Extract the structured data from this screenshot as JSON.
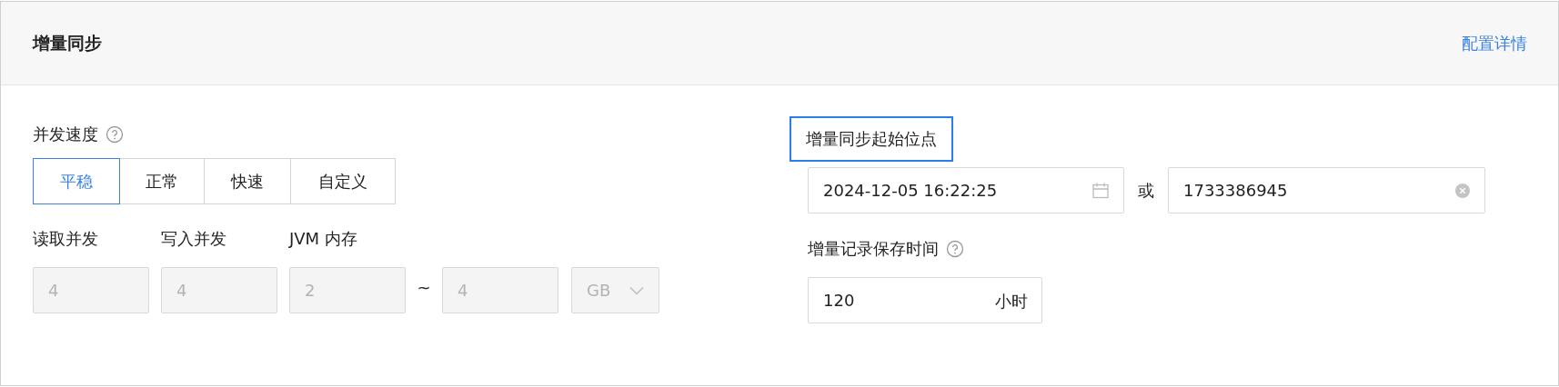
{
  "header": {
    "title": "增量同步",
    "link": "配置详情"
  },
  "concurrency": {
    "label": "并发速度",
    "options": [
      {
        "label": "平稳",
        "selected": true
      },
      {
        "label": "正常",
        "selected": false
      },
      {
        "label": "快速",
        "selected": false
      },
      {
        "label": "自定义",
        "selected": false
      }
    ]
  },
  "resources": {
    "fields": [
      {
        "label": "读取并发",
        "value": "4",
        "disabled": true
      },
      {
        "label": "写入并发",
        "value": "4",
        "disabled": true
      },
      {
        "label": "JVM 内存",
        "value": "2",
        "disabled": true
      }
    ],
    "range_separator": "~",
    "range_max": {
      "value": "4",
      "disabled": true
    },
    "unit": {
      "value": "GB",
      "disabled": true
    }
  },
  "start_position": {
    "label": "增量同步起始位点",
    "focused": true,
    "datetime": "2024-12-05 16:22:25",
    "separator": "或",
    "timestamp": "1733386945"
  },
  "retention": {
    "label": "增量记录保存时间",
    "value": "120",
    "unit": "小时"
  }
}
